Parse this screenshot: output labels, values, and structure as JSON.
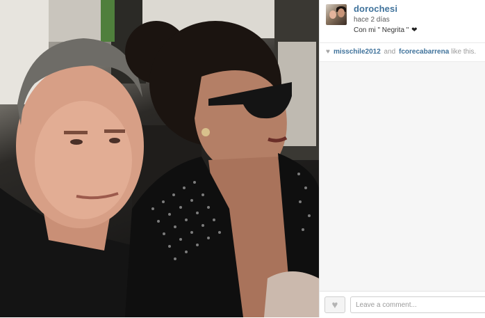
{
  "post": {
    "username": "dorochesi",
    "time_ago": "hace 2 días",
    "caption_text": "Con mi \" Negrita \"",
    "caption_emoji": "❤"
  },
  "likes": {
    "heart_icon": "♥",
    "user1": "misschile2012",
    "conjunction": "and",
    "user2": "fcorecabarrena",
    "suffix": "like this."
  },
  "footer": {
    "like_button_icon": "♥",
    "comment_placeholder": "Leave a comment..."
  },
  "colors": {
    "username": "#3f729b",
    "comments_bg": "#f6f6f6"
  }
}
